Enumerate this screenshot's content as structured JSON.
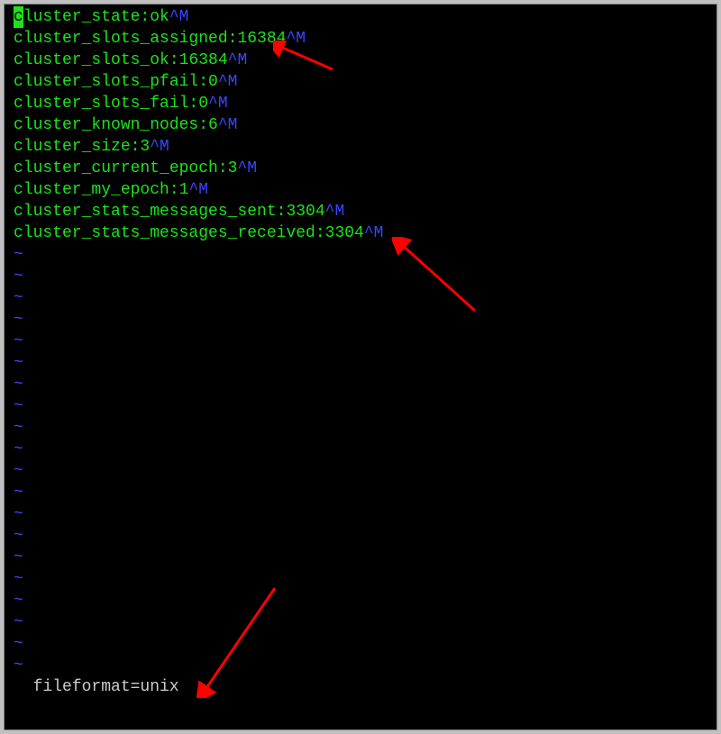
{
  "cursor_char": "c",
  "lines": [
    {
      "text_after_cursor": "luster_state:ok",
      "cr": "^M"
    },
    {
      "text": "cluster_slots_assigned:16384",
      "cr": "^M"
    },
    {
      "text": "cluster_slots_ok:16384",
      "cr": "^M"
    },
    {
      "text": "cluster_slots_pfail:0",
      "cr": "^M"
    },
    {
      "text": "cluster_slots_fail:0",
      "cr": "^M"
    },
    {
      "text": "cluster_known_nodes:6",
      "cr": "^M"
    },
    {
      "text": "cluster_size:3",
      "cr": "^M"
    },
    {
      "text": "cluster_current_epoch:3",
      "cr": "^M"
    },
    {
      "text": "cluster_my_epoch:1",
      "cr": "^M"
    },
    {
      "text": "cluster_stats_messages_sent:3304",
      "cr": "^M"
    },
    {
      "text": "cluster_stats_messages_received:3304",
      "cr": "^M"
    }
  ],
  "tilde": "~",
  "tilde_count": 20,
  "status": "  fileformat=unix"
}
